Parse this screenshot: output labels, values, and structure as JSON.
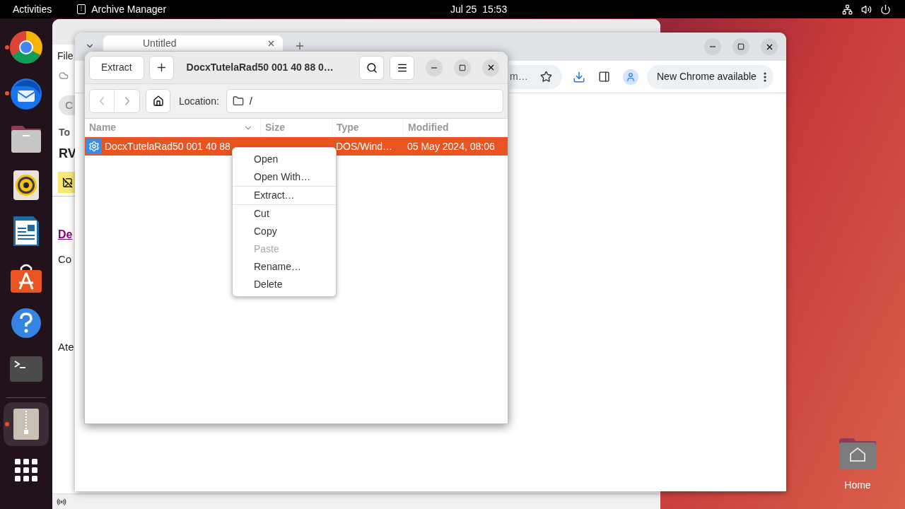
{
  "top_bar": {
    "activities": "Activities",
    "app_name": "Archive Manager",
    "clock": "Jul 25  15:53"
  },
  "dock": {
    "items": [
      {
        "kind": "chrome",
        "running": true,
        "selected": false
      },
      {
        "kind": "thunderbird",
        "running": true,
        "selected": false
      },
      {
        "kind": "files",
        "running": false,
        "selected": false
      },
      {
        "kind": "rhythmbox",
        "running": false,
        "selected": false
      },
      {
        "kind": "writer",
        "running": false,
        "selected": false
      },
      {
        "kind": "appcenter",
        "running": false,
        "selected": false
      },
      {
        "kind": "help",
        "running": false,
        "selected": false
      },
      {
        "kind": "terminal",
        "running": false,
        "selected": false
      },
      {
        "kind": "archive",
        "running": true,
        "selected": true
      },
      {
        "kind": "grid",
        "running": false,
        "selected": false
      }
    ]
  },
  "thunderbird": {
    "menu_fragment": "File",
    "button_fragment": "C",
    "to_label": "To",
    "subject_fragment": "RV",
    "link_fragment": "De",
    "body_fragments": [
      "Co",
      "Ate"
    ]
  },
  "chrome": {
    "tab_title": "Untitled",
    "address_fragment": "m…",
    "update_button": "New Chrome available"
  },
  "archive_manager": {
    "extract_button": "Extract",
    "title": "DocxTutelaRad50 001 40 88 0…",
    "location_label": "Location:",
    "location": "/",
    "columns": [
      "Name",
      "Size",
      "Type",
      "Modified"
    ],
    "rows": [
      {
        "selected": true,
        "name": "DocxTutelaRad50 001 40 88",
        "type": "DOS/Wind…",
        "modified": "05 May 2024, 08:06"
      }
    ]
  },
  "context_menu": {
    "items": [
      {
        "label": "Open",
        "disabled": false,
        "separator_after": false
      },
      {
        "label": "Open With…",
        "disabled": false,
        "separator_after": true
      },
      {
        "label": "Extract…",
        "disabled": false,
        "separator_after": true
      },
      {
        "label": "Cut",
        "disabled": false,
        "separator_after": false
      },
      {
        "label": "Copy",
        "disabled": false,
        "separator_after": false
      },
      {
        "label": "Paste",
        "disabled": true,
        "separator_after": false
      },
      {
        "label": "Rename…",
        "disabled": false,
        "separator_after": false
      },
      {
        "label": "Delete",
        "disabled": false,
        "separator_after": false
      }
    ]
  },
  "desktop": {
    "icons": [
      {
        "label": "Home"
      }
    ]
  }
}
